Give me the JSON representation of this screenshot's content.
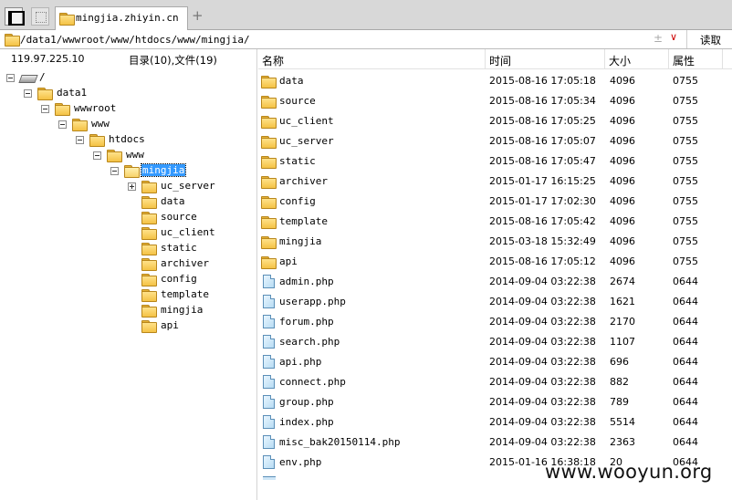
{
  "tab": {
    "title": "mingjia.zhiyin.cn",
    "add_symbol": "+"
  },
  "address": {
    "path": "/data1/wwwroot/www/htdocs/www/mingjia/",
    "read_label": "读取"
  },
  "tree": {
    "ip": "119.97.225.10",
    "dir_file_count": "目录(10),文件(19)",
    "nodes": [
      {
        "label": "/",
        "selected": false
      },
      {
        "label": "data1",
        "selected": false
      },
      {
        "label": "wwwroot",
        "selected": false
      },
      {
        "label": "www",
        "selected": false
      },
      {
        "label": "htdocs",
        "selected": false
      },
      {
        "label": "www",
        "selected": false
      },
      {
        "label": "mingjia",
        "selected": true
      },
      {
        "label": "uc_server",
        "selected": false
      },
      {
        "label": "data",
        "selected": false
      },
      {
        "label": "source",
        "selected": false
      },
      {
        "label": "uc_client",
        "selected": false
      },
      {
        "label": "static",
        "selected": false
      },
      {
        "label": "archiver",
        "selected": false
      },
      {
        "label": "config",
        "selected": false
      },
      {
        "label": "template",
        "selected": false
      },
      {
        "label": "mingjia",
        "selected": false
      },
      {
        "label": "api",
        "selected": false
      }
    ]
  },
  "list": {
    "headers": {
      "name": "名称",
      "time": "时间",
      "size": "大小",
      "perm": "属性"
    },
    "rows": [
      {
        "type": "dir",
        "name": "data",
        "time": "2015-08-16 17:05:18",
        "size": "4096",
        "perm": "0755"
      },
      {
        "type": "dir",
        "name": "source",
        "time": "2015-08-16 17:05:34",
        "size": "4096",
        "perm": "0755"
      },
      {
        "type": "dir",
        "name": "uc_client",
        "time": "2015-08-16 17:05:25",
        "size": "4096",
        "perm": "0755"
      },
      {
        "type": "dir",
        "name": "uc_server",
        "time": "2015-08-16 17:05:07",
        "size": "4096",
        "perm": "0755"
      },
      {
        "type": "dir",
        "name": "static",
        "time": "2015-08-16 17:05:47",
        "size": "4096",
        "perm": "0755"
      },
      {
        "type": "dir",
        "name": "archiver",
        "time": "2015-01-17 16:15:25",
        "size": "4096",
        "perm": "0755"
      },
      {
        "type": "dir",
        "name": "config",
        "time": "2015-01-17 17:02:30",
        "size": "4096",
        "perm": "0755"
      },
      {
        "type": "dir",
        "name": "template",
        "time": "2015-08-16 17:05:42",
        "size": "4096",
        "perm": "0755"
      },
      {
        "type": "dir",
        "name": "mingjia",
        "time": "2015-03-18 15:32:49",
        "size": "4096",
        "perm": "0755"
      },
      {
        "type": "dir",
        "name": "api",
        "time": "2015-08-16 17:05:12",
        "size": "4096",
        "perm": "0755"
      },
      {
        "type": "file",
        "name": "admin.php",
        "time": "2014-09-04 03:22:38",
        "size": "2674",
        "perm": "0644"
      },
      {
        "type": "file",
        "name": "userapp.php",
        "time": "2014-09-04 03:22:38",
        "size": "1621",
        "perm": "0644"
      },
      {
        "type": "file",
        "name": "forum.php",
        "time": "2014-09-04 03:22:38",
        "size": "2170",
        "perm": "0644"
      },
      {
        "type": "file",
        "name": "search.php",
        "time": "2014-09-04 03:22:38",
        "size": "1107",
        "perm": "0644"
      },
      {
        "type": "file",
        "name": "api.php",
        "time": "2014-09-04 03:22:38",
        "size": "696",
        "perm": "0644"
      },
      {
        "type": "file",
        "name": "connect.php",
        "time": "2014-09-04 03:22:38",
        "size": "882",
        "perm": "0644"
      },
      {
        "type": "file",
        "name": "group.php",
        "time": "2014-09-04 03:22:38",
        "size": "789",
        "perm": "0644"
      },
      {
        "type": "file",
        "name": "index.php",
        "time": "2014-09-04 03:22:38",
        "size": "5514",
        "perm": "0644"
      },
      {
        "type": "file",
        "name": "misc_bak20150114.php",
        "time": "2014-09-04 03:22:38",
        "size": "2363",
        "perm": "0644"
      },
      {
        "type": "file",
        "name": "env.php",
        "time": "2015-01-16 16:38:18",
        "size": "20",
        "perm": "0644"
      }
    ]
  },
  "watermark": "www.wooyun.org"
}
